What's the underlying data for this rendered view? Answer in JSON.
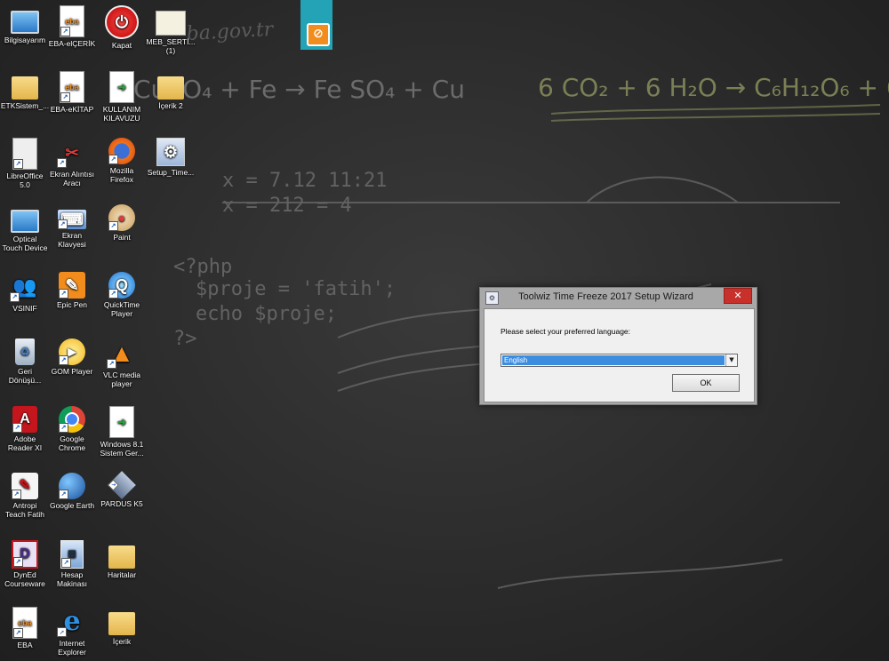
{
  "desktop": {
    "icons": [
      {
        "label": "Bilgisayarım",
        "icon": "computer-icon"
      },
      {
        "label": "EBA-elÇERİK",
        "icon": "eba-icon"
      },
      {
        "label": "Kapat",
        "icon": "power-icon"
      },
      {
        "label": "MEB_SERTİ...\n(1)",
        "icon": "certificate-icon"
      },
      {
        "label": "ETKSistem_...",
        "icon": "folder-icon"
      },
      {
        "label": "EBA-eKİTAP",
        "icon": "eba-icon"
      },
      {
        "label": "KULLANIM\nKILAVUZU",
        "icon": "document-icon"
      },
      {
        "label": "İçerik 2",
        "icon": "folder-icon"
      },
      {
        "label": "LibreOffice\n5.0",
        "icon": "libreoffice-icon"
      },
      {
        "label": "Ekran Alıntısı\nAracı",
        "icon": "snipping-tool-icon"
      },
      {
        "label": "Mozilla\nFirefox",
        "icon": "firefox-icon"
      },
      {
        "label": "Setup_Time...",
        "icon": "setup-icon"
      },
      {
        "label": "Optical\nTouch Device",
        "icon": "monitor-icon"
      },
      {
        "label": "Ekran\nKlavyesi",
        "icon": "keyboard-icon"
      },
      {
        "label": "Paint",
        "icon": "paint-icon"
      },
      {
        "label": "VSINIF",
        "icon": "users-icon"
      },
      {
        "label": "Epic Pen",
        "icon": "pen-icon"
      },
      {
        "label": "QuickTime\nPlayer",
        "icon": "quicktime-icon"
      },
      {
        "label": "Geri\nDönüşü...",
        "icon": "recycle-bin-icon"
      },
      {
        "label": "GOM Player",
        "icon": "gom-player-icon"
      },
      {
        "label": "VLC media\nplayer",
        "icon": "vlc-icon"
      },
      {
        "label": "Adobe\nReader XI",
        "icon": "adobe-reader-icon"
      },
      {
        "label": "Google\nChrome",
        "icon": "chrome-icon"
      },
      {
        "label": "Windows 8.1\nSistem Ger...",
        "icon": "document-icon"
      },
      {
        "label": "Antropi\nTeach Fatih",
        "icon": "antropi-icon"
      },
      {
        "label": "Google Earth",
        "icon": "google-earth-icon"
      },
      {
        "label": "PARDUS K5",
        "icon": "pardus-icon"
      },
      {
        "label": "DynEd\nCourseware",
        "icon": "dyned-icon"
      },
      {
        "label": "Hesap\nMakinası",
        "icon": "calculator-icon"
      },
      {
        "label": "Haritalar",
        "icon": "folder-icon"
      },
      {
        "label": "EBA",
        "icon": "eba-icon"
      },
      {
        "label": "Internet\nExplorer",
        "icon": "internet-explorer-icon"
      },
      {
        "label": "İçerik",
        "icon": "folder-icon"
      }
    ]
  },
  "sidebar_app": {
    "icon": "epic-pen-sidebar-icon",
    "glyph": "⊘"
  },
  "dialog": {
    "title": "Toolwiz Time Freeze 2017 Setup Wizard",
    "close_label": "✕",
    "prompt": "Please select your preferred language:",
    "language_value": "English",
    "ok_label": "OK"
  },
  "colors": {
    "accent": "#3c8de0",
    "close": "#c7302b"
  }
}
